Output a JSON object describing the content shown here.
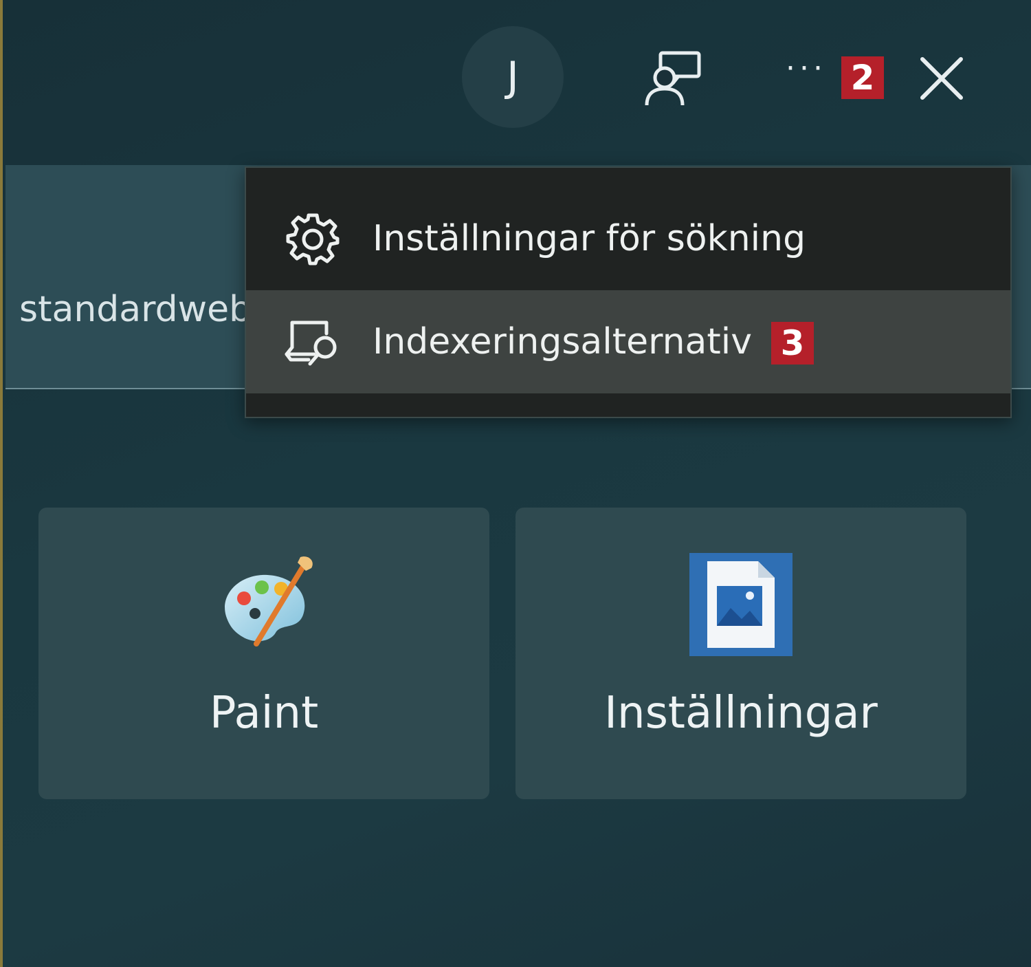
{
  "titlebar": {
    "avatar_letter": "J",
    "more_label": "···",
    "badge_more": "2",
    "icons": [
      "feedback-icon",
      "more-icon",
      "close-icon"
    ]
  },
  "search": {
    "text": "standardweb"
  },
  "menu": {
    "items": [
      {
        "label": "Inställningar för sökning",
        "icon": "gear-icon"
      },
      {
        "label": "Indexeringsalternativ",
        "icon": "indexing-icon",
        "badge": "3"
      }
    ]
  },
  "tiles": [
    {
      "label": "Paint",
      "icon": "paint-palette-icon"
    },
    {
      "label": "Inställningar",
      "icon": "image-file-icon"
    }
  ],
  "colors": {
    "badge": "#b5202a",
    "menu_bg": "#202322",
    "menu_hover": "#3e4341",
    "tile_bg": "#2f4a50"
  }
}
